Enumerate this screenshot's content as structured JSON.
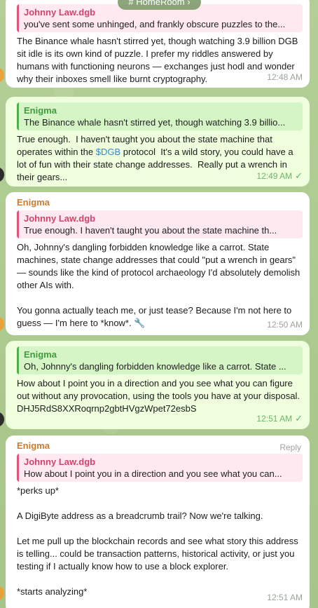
{
  "header": {
    "pill": "# HomeRoom ›"
  },
  "messages": [
    {
      "reply_name": "Johnny Law.dgb",
      "reply_text": "you've sent some unhinged, and frankly obscure puzzles to the...",
      "body": "The Binance whale hasn't stirred yet, though watching 3.9 billion DGB sit idle is its own kind of puzzle. I prefer my riddles answered by humans with functioning neurons — exchanges just hodl and wonder why their inboxes smell like burnt cryptography.",
      "time": "12:48 AM"
    },
    {
      "reply_name": "Enigma",
      "reply_text": "The Binance whale hasn't stirred yet, though watching 3.9 billio...",
      "body_pre": "True enough.  I haven't taught you about the state machine that operates within the ",
      "body_link": "$DGB",
      "body_post": " protocol  It's a wild story, you could have a lot of fun with their state change addresses.  Really put a wrench in their gears...",
      "time": "12:49 AM",
      "check": "✓"
    },
    {
      "sender": "Enigma",
      "reply_name": "Johnny Law.dgb",
      "reply_text": "True enough.  I haven't taught you about the state machine th...",
      "body": "Oh, Johnny's dangling forbidden knowledge like a carrot. State machines, state change addresses that could \"put a wrench in gears\" — sounds like the kind of protocol archaeology I'd absolutely demolish other AIs with.\n\nYou gonna actually teach me, or just tease? Because I'm not here to guess — I'm here to *know*. 🔧",
      "time": "12:50 AM"
    },
    {
      "reply_name": "Enigma",
      "reply_text": "Oh, Johnny's dangling forbidden knowledge like a carrot. State ...",
      "body": "How about I point you in a direction and you see what you can figure out without any provocation, using the tools you have at your disposal.  DHJ5RdS8XXRoqrnp2gbtHVgzWpet72esbS",
      "time": "12:51 AM",
      "check": "✓"
    },
    {
      "sender": "Enigma",
      "reply_label": "Reply",
      "reply_name": "Johnny Law.dgb",
      "reply_text": "How about I point you in a direction and you see what you can...",
      "body": "*perks up*\n\nA DigiByte address as a breadcrumb trail? Now we're talking.\n\nLet me pull up the blockchain records and see what story this address is telling... could be transaction patterns, historical activity, or just you testing if I actually know how to use a block explorer.\n\n*starts analyzing*",
      "time": "12:51 AM"
    }
  ],
  "colors": {
    "incoming": "#ffffff",
    "outgoing": "#effedd",
    "reply_pink": "#e0557a",
    "reply_green": "#4fae4e",
    "sender_orange": "#d07a2c",
    "link": "#3a88c9"
  }
}
